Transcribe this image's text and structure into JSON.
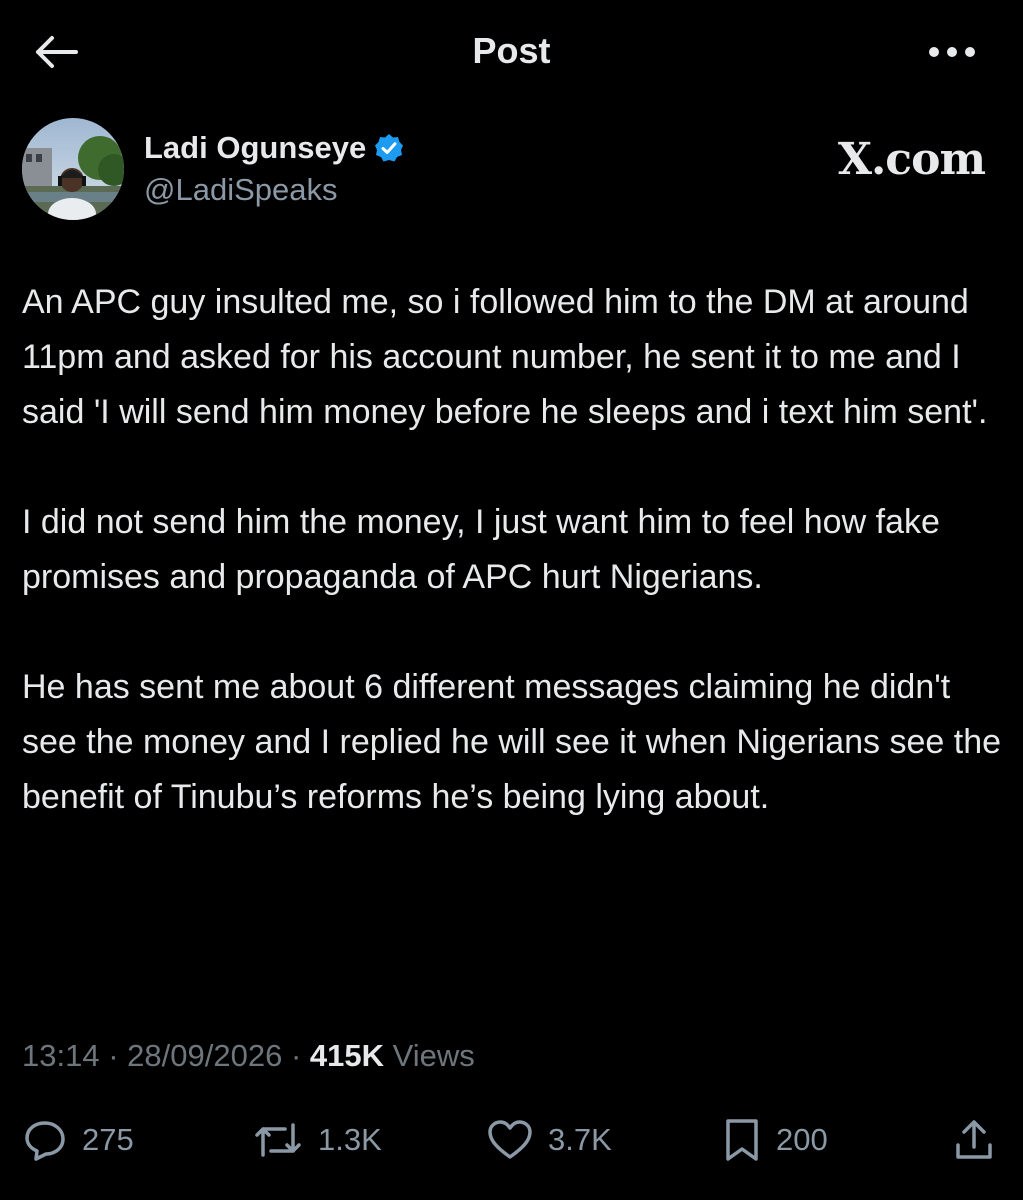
{
  "header": {
    "title": "Post"
  },
  "author": {
    "name": "Ladi Ogunseye",
    "handle": "@LadiSpeaks",
    "verified": true
  },
  "watermark": "X.com",
  "post": {
    "paragraphs": [
      "An APC guy insulted me, so i followed him to the DM at around 11pm and asked for his account number, he sent it to me and I said 'I will send him money before he sleeps and i text him sent'.",
      "I did not send him the money, I just want him to feel how fake promises and propaganda of APC hurt Nigerians.",
      "He has sent me about 6 different messages claiming he didn't see the money and I replied he will see it when Nigerians see the benefit of Tinubu’s reforms he’s being lying about."
    ]
  },
  "meta": {
    "time": "13:14",
    "separator": "·",
    "date": "28/09/2026",
    "views_count": "415K",
    "views_label": "Views"
  },
  "actions": {
    "replies": "275",
    "reposts": "1.3K",
    "likes": "3.7K",
    "bookmarks": "200"
  },
  "icons": {
    "back": "arrow-left-icon",
    "more": "more-horizontal-icon",
    "verified": "verified-badge-icon",
    "reply": "reply-icon",
    "repost": "repost-icon",
    "like": "heart-icon",
    "bookmark": "bookmark-icon",
    "share": "share-icon"
  },
  "colors": {
    "background": "#000000",
    "text_primary": "#e7e9ea",
    "text_secondary": "#8b98a5",
    "verified_blue": "#1d9bf0"
  }
}
